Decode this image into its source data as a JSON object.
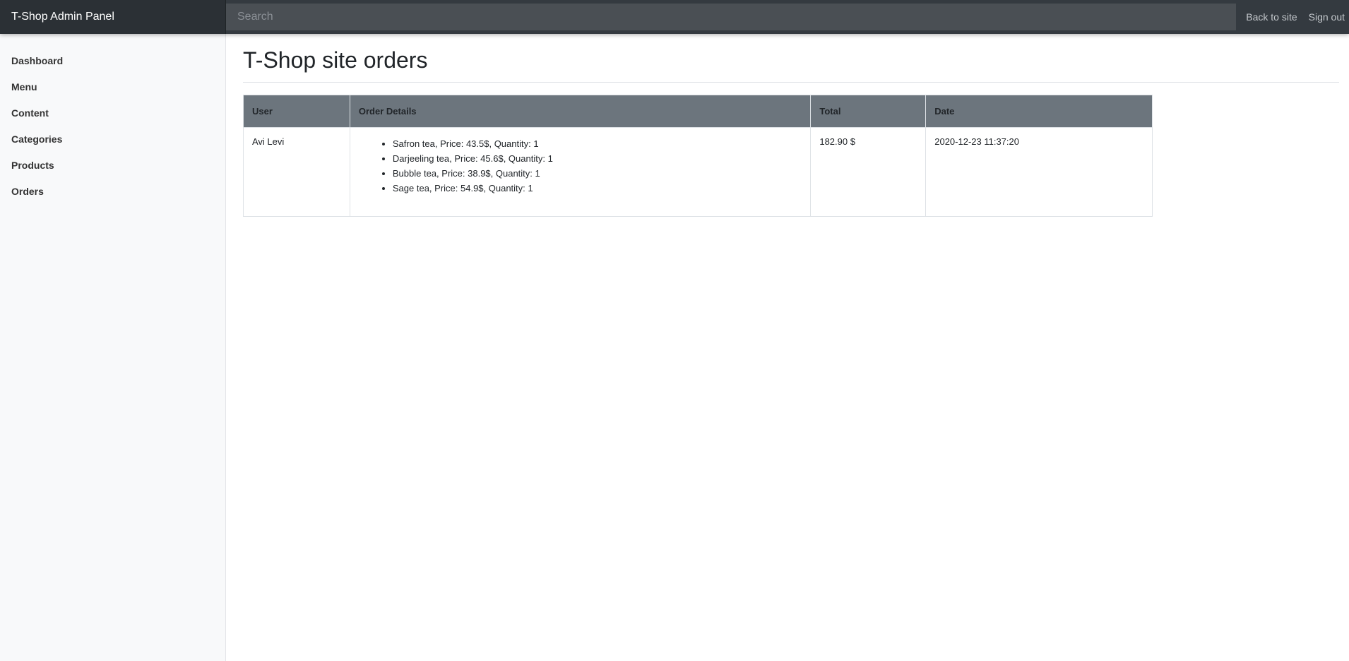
{
  "header": {
    "brand": "T-Shop Admin Panel",
    "search_placeholder": "Search",
    "links": [
      {
        "label": "Back to site"
      },
      {
        "label": "Sign out"
      }
    ]
  },
  "sidebar": {
    "items": [
      {
        "label": "Dashboard"
      },
      {
        "label": "Menu"
      },
      {
        "label": "Content"
      },
      {
        "label": "Categories"
      },
      {
        "label": "Products"
      },
      {
        "label": "Orders"
      }
    ]
  },
  "main": {
    "title": "T-Shop site orders",
    "table": {
      "columns": [
        "User",
        "Order Details",
        "Total",
        "Date"
      ],
      "rows": [
        {
          "user": "Avi Levi",
          "details": [
            "Safron tea, Price: 43.5$, Quantity: 1",
            "Darjeeling tea, Price: 45.6$, Quantity: 1",
            "Bubble tea, Price: 38.9$, Quantity: 1",
            "Sage tea, Price: 54.9$, Quantity: 1"
          ],
          "total": "182.90 $",
          "date": "2020-12-23 11:37:20"
        }
      ]
    }
  }
}
